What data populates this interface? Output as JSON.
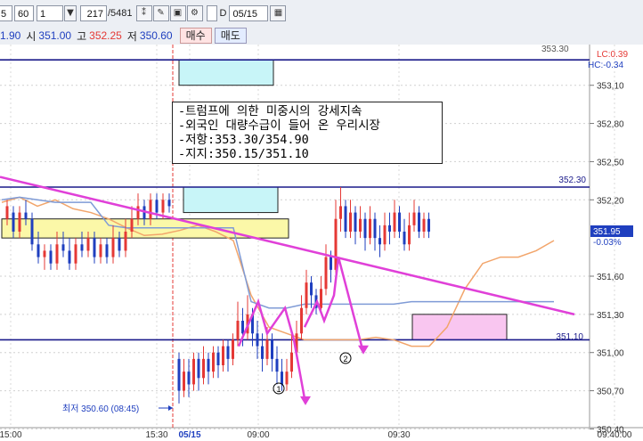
{
  "toolbar": {
    "interval": "5",
    "interval_unit": "60",
    "count": "1",
    "position": "217",
    "total": "/5481",
    "date_checkbox_label": "D",
    "date": "05/15"
  },
  "quote": {
    "prev_partial": "1.90",
    "open_label": "시",
    "open": "351.00",
    "high_label": "고",
    "high": "352.25",
    "low_label": "저",
    "low": "350.60",
    "buy_label": "매수",
    "sell_label": "매도"
  },
  "annotation": {
    "lines": [
      "-트럼프에 의한 미중시의 강세지속",
      "-외국인 대량수급이 들어 온 우리시장",
      "-저항:353.30/354.90",
      "-지지:350.15/351.10"
    ]
  },
  "labels": {
    "lc": "LC:0.39",
    "hc": "HC:-0.34",
    "resistance_top": "353.30",
    "resistance_mid": "352.30",
    "support": "351.10",
    "current_price": "351.95",
    "current_change": "-0.03%",
    "low_marker": "최저 350.60 (08:45)",
    "circle_1": "1",
    "circle_2": "2"
  },
  "colors": {
    "up": "#e53935",
    "down": "#1f3fbf",
    "trendline": "#e040d8",
    "hline": "#1a1a8a",
    "orange": "#f2a56b",
    "blue_line": "#7f9bd6",
    "yellow_zone": "#fbf8a8",
    "cyan_zone": "#c8f5f8",
    "pink_zone": "#f9c6f0"
  },
  "chart_data": {
    "type": "candlestick",
    "yaxis": {
      "min": 350.55,
      "max": 353.35,
      "ticks": [
        "353,10",
        "352,80",
        "352,50",
        "352,20",
        "351,60",
        "351,30",
        "351,00",
        "350,70",
        "350,40"
      ]
    },
    "xaxis": {
      "ticks": [
        "15:00",
        "15:30",
        "05/15",
        "09:00",
        "09:30",
        "09:40:00"
      ]
    },
    "horizontal_lines": [
      353.3,
      352.3,
      351.1
    ],
    "zones": [
      {
        "kind": "resistance",
        "low": 353.1,
        "high": 353.3
      },
      {
        "kind": "resistance",
        "low": 352.1,
        "high": 352.3
      },
      {
        "kind": "support",
        "low": 351.1,
        "high": 351.3
      },
      {
        "kind": "prior-range",
        "low": 351.9,
        "high": 352.05
      }
    ],
    "trend_line": {
      "start": 352.38,
      "end": 351.3
    },
    "orange_line": [
      352.18,
      352.22,
      352.15,
      352.2,
      352.13,
      352.1,
      352.05,
      351.98,
      351.92,
      351.93,
      351.96,
      352.0,
      351.95,
      351.88,
      351.45,
      351.2,
      351.15,
      351.1,
      351.1,
      351.1,
      351.1,
      351.12,
      351.1,
      351.05,
      351.05,
      351.2,
      351.5,
      351.7,
      351.75,
      351.75,
      351.8,
      351.88
    ],
    "blue_line": [
      352.2,
      352.22,
      352.2,
      352.18,
      352.18,
      352.18,
      352.0,
      351.98,
      351.98,
      351.98,
      351.98,
      351.98,
      351.98,
      351.98,
      351.4,
      351.35,
      351.35,
      351.38,
      351.38,
      351.38,
      351.38,
      351.38,
      351.38,
      351.4,
      351.4,
      351.4,
      351.4,
      351.4,
      351.4,
      351.4,
      351.4,
      351.4
    ],
    "pre_close_candles": [
      [
        352.05,
        352.15,
        352.2,
        352.0
      ],
      [
        352.1,
        351.95,
        352.15,
        351.9
      ],
      [
        351.95,
        352.1,
        352.15,
        351.9
      ],
      [
        352.1,
        352.05,
        352.2,
        352.0
      ],
      [
        352.05,
        351.85,
        352.1,
        351.8
      ],
      [
        351.85,
        351.75,
        351.95,
        351.7
      ],
      [
        351.75,
        351.8,
        351.85,
        351.65
      ],
      [
        351.8,
        351.7,
        351.85,
        351.65
      ],
      [
        351.7,
        351.85,
        351.95,
        351.65
      ],
      [
        351.85,
        351.8,
        351.95,
        351.75
      ],
      [
        351.8,
        351.7,
        351.9,
        351.65
      ],
      [
        351.7,
        351.85,
        351.9,
        351.65
      ],
      [
        351.85,
        351.8,
        351.95,
        351.75
      ],
      [
        351.8,
        351.9,
        351.95,
        351.75
      ],
      [
        351.9,
        351.75,
        351.95,
        351.7
      ],
      [
        351.75,
        351.85,
        351.9,
        351.7
      ],
      [
        351.85,
        351.75,
        351.9,
        351.7
      ],
      [
        351.75,
        351.9,
        352.0,
        351.7
      ],
      [
        351.9,
        351.8,
        351.95,
        351.75
      ],
      [
        351.8,
        351.95,
        352.05,
        351.75
      ],
      [
        351.95,
        352.05,
        352.15,
        351.9
      ],
      [
        352.05,
        352.15,
        352.25,
        352.0
      ],
      [
        352.15,
        352.05,
        352.2,
        352.0
      ],
      [
        352.05,
        352.2,
        352.25,
        352.0
      ],
      [
        352.2,
        352.1,
        352.25,
        352.05
      ],
      [
        352.1,
        352.2,
        352.25,
        352.05
      ],
      [
        352.2,
        352.15,
        352.25,
        352.1
      ]
    ],
    "candles": [
      [
        350.95,
        350.7,
        351.0,
        350.6
      ],
      [
        350.7,
        350.85,
        350.95,
        350.65
      ],
      [
        350.85,
        350.75,
        350.95,
        350.65
      ],
      [
        350.75,
        350.95,
        351.0,
        350.7
      ],
      [
        350.95,
        350.8,
        351.0,
        350.7
      ],
      [
        350.8,
        350.95,
        351.05,
        350.75
      ],
      [
        350.95,
        350.85,
        351.0,
        350.75
      ],
      [
        350.85,
        351.0,
        351.05,
        350.8
      ],
      [
        351.0,
        350.9,
        351.05,
        350.8
      ],
      [
        350.9,
        351.05,
        351.1,
        350.85
      ],
      [
        351.05,
        350.95,
        351.1,
        350.85
      ],
      [
        350.95,
        351.1,
        351.15,
        350.9
      ],
      [
        351.1,
        351.25,
        351.4,
        351.05
      ],
      [
        351.25,
        351.15,
        351.35,
        351.05
      ],
      [
        351.15,
        351.3,
        351.45,
        351.1
      ],
      [
        351.3,
        351.15,
        351.35,
        351.05
      ],
      [
        351.15,
        351.05,
        351.25,
        350.95
      ],
      [
        351.05,
        350.95,
        351.15,
        350.85
      ],
      [
        350.95,
        351.1,
        351.2,
        350.9
      ],
      [
        351.1,
        350.95,
        351.15,
        350.85
      ],
      [
        350.95,
        350.85,
        351.05,
        350.75
      ],
      [
        350.85,
        350.75,
        350.95,
        350.7
      ],
      [
        350.75,
        350.85,
        350.95,
        350.7
      ],
      [
        350.85,
        351.0,
        351.15,
        350.8
      ],
      [
        351.0,
        351.15,
        351.25,
        350.95
      ],
      [
        351.15,
        351.35,
        351.45,
        351.1
      ],
      [
        351.35,
        351.55,
        351.65,
        351.3
      ],
      [
        351.55,
        351.45,
        351.6,
        351.35
      ],
      [
        351.45,
        351.35,
        351.5,
        351.3
      ],
      [
        351.35,
        351.5,
        351.6,
        351.3
      ],
      [
        351.5,
        351.75,
        351.85,
        351.45
      ],
      [
        351.75,
        351.65,
        351.8,
        351.55
      ],
      [
        351.65,
        352.05,
        352.2,
        351.6
      ],
      [
        352.05,
        352.15,
        352.3,
        351.95
      ],
      [
        352.15,
        351.95,
        352.2,
        351.9
      ],
      [
        351.95,
        352.1,
        352.2,
        351.9
      ],
      [
        352.1,
        351.95,
        352.15,
        351.85
      ],
      [
        351.95,
        352.05,
        352.15,
        351.9
      ],
      [
        352.05,
        351.9,
        352.1,
        351.8
      ],
      [
        351.9,
        352.05,
        352.15,
        351.85
      ],
      [
        352.05,
        351.9,
        352.1,
        351.8
      ],
      [
        351.9,
        351.85,
        352.0,
        351.75
      ],
      [
        351.85,
        352.0,
        352.1,
        351.8
      ],
      [
        352.0,
        351.95,
        352.1,
        351.85
      ],
      [
        351.95,
        352.1,
        352.2,
        351.9
      ],
      [
        352.1,
        351.95,
        352.15,
        351.9
      ],
      [
        351.95,
        351.85,
        352.05,
        351.8
      ],
      [
        351.85,
        352.0,
        352.1,
        351.8
      ],
      [
        352.0,
        352.1,
        352.2,
        351.95
      ],
      [
        352.1,
        351.95,
        352.15,
        351.9
      ],
      [
        351.95,
        352.05,
        352.1,
        351.9
      ],
      [
        352.05,
        351.95,
        352.1,
        351.9
      ]
    ],
    "forecast_arrows": [
      {
        "label": "1",
        "path": [
          351.05,
          351.4,
          351.15,
          351.35,
          351.1,
          350.6
        ]
      },
      {
        "label": "2",
        "path": [
          351.2,
          351.4,
          351.25,
          351.45,
          351.75,
          351.0
        ]
      }
    ]
  }
}
